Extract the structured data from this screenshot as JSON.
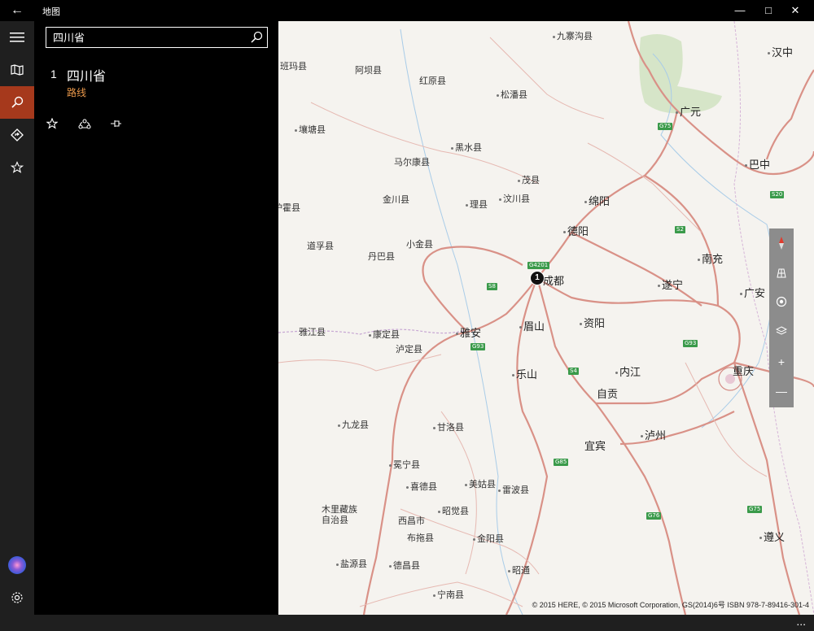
{
  "window": {
    "title": "地图",
    "back_icon": "←",
    "minimize_icon": "—",
    "maximize_icon": "□",
    "close_icon": "✕"
  },
  "search": {
    "value": "四川省",
    "placeholder": ""
  },
  "result": {
    "index": "1",
    "name": "四川省",
    "route_label": "路线",
    "route_color": "#e8974a"
  },
  "rail": {
    "active_color": "#a6391c"
  },
  "map": {
    "pin_label": "1",
    "copyright": "© 2015 HERE, © 2015 Microsoft Corporation, GS(2014)6号 ISBN 978-7-89416-301-4",
    "cities": [
      {
        "name": "九寨沟县"
      },
      {
        "name": "汉中"
      },
      {
        "name": "班玛县"
      },
      {
        "name": "阿坝县"
      },
      {
        "name": "红原县"
      },
      {
        "name": "松潘县"
      },
      {
        "name": "广元"
      },
      {
        "name": "壤塘县"
      },
      {
        "name": "黑水县"
      },
      {
        "name": "马尔康县"
      },
      {
        "name": "巴中"
      },
      {
        "name": "茂县"
      },
      {
        "name": "金川县"
      },
      {
        "name": "理县"
      },
      {
        "name": "汶川县"
      },
      {
        "name": "绵阳"
      },
      {
        "name": "炉霍县"
      },
      {
        "name": "德阳"
      },
      {
        "name": "道孚县"
      },
      {
        "name": "小金县"
      },
      {
        "name": "丹巴县"
      },
      {
        "name": "南充"
      },
      {
        "name": "成都"
      },
      {
        "name": "遂宁"
      },
      {
        "name": "广安"
      },
      {
        "name": "雅江县"
      },
      {
        "name": "康定县"
      },
      {
        "name": "雅安"
      },
      {
        "name": "眉山"
      },
      {
        "name": "资阳"
      },
      {
        "name": "泸定县"
      },
      {
        "name": "乐山"
      },
      {
        "name": "内江"
      },
      {
        "name": "重庆"
      },
      {
        "name": "自贡"
      },
      {
        "name": "九龙县"
      },
      {
        "name": "甘洛县"
      },
      {
        "name": "泸州"
      },
      {
        "name": "宜宾"
      },
      {
        "name": "冕宁县"
      },
      {
        "name": "喜德县"
      },
      {
        "name": "美姑县"
      },
      {
        "name": "雷波县"
      },
      {
        "name": "木里藏族"
      },
      {
        "name": "自治县"
      },
      {
        "name": "西昌市"
      },
      {
        "name": "昭觉县"
      },
      {
        "name": "遵义"
      },
      {
        "name": "布拖县"
      },
      {
        "name": "金阳县"
      },
      {
        "name": "盐源县"
      },
      {
        "name": "德昌县"
      },
      {
        "name": "昭通"
      },
      {
        "name": "宁南县"
      }
    ],
    "shields": [
      "G75",
      "S20",
      "S2",
      "G4201",
      "S8",
      "G93",
      "S4",
      "G93",
      "G85",
      "G76",
      "G75"
    ]
  },
  "controls": {
    "compass_icon": "compass-icon",
    "tilt_icon": "tilt-icon",
    "locate_icon": "locate-icon",
    "layers_icon": "layers-icon",
    "zoom_in": "+",
    "zoom_out": "—"
  },
  "statusbar": {
    "more": "..."
  }
}
